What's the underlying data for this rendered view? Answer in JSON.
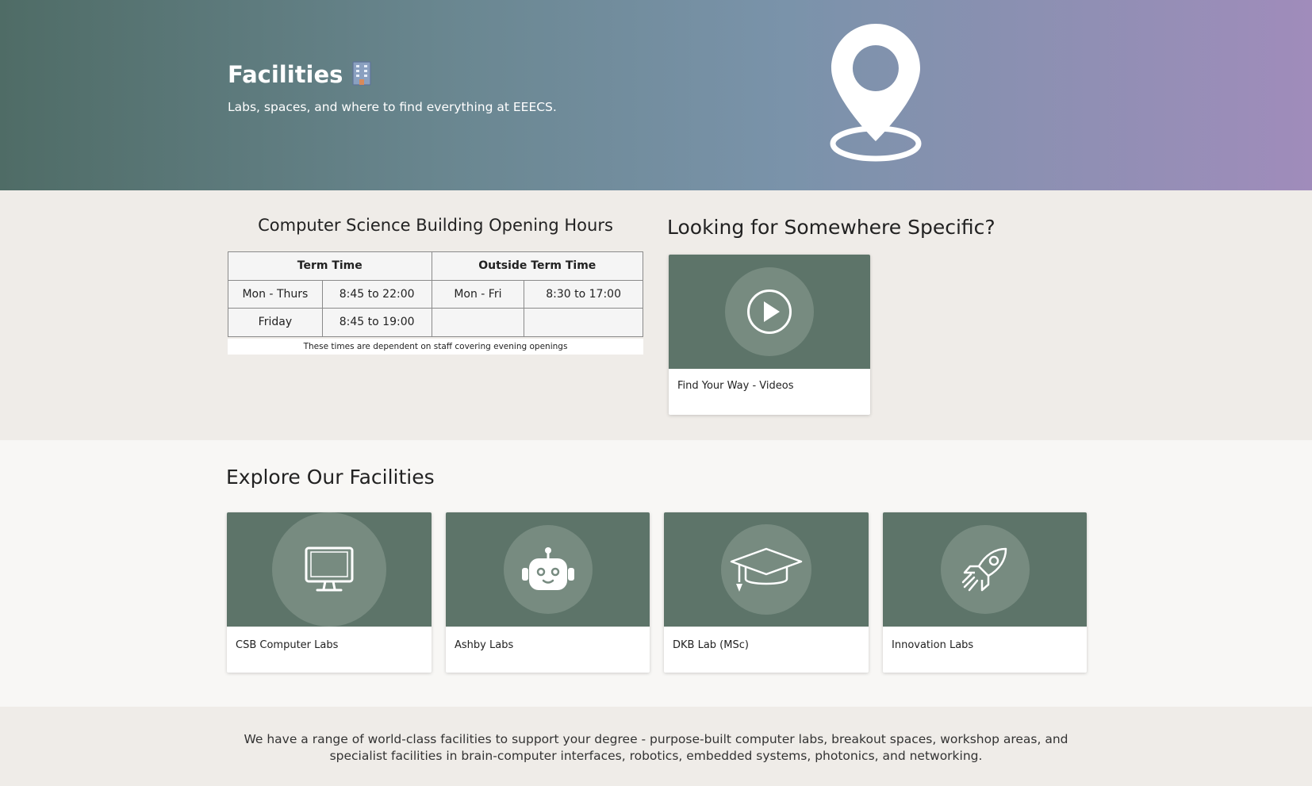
{
  "hero": {
    "title": "Facilities",
    "subtitle": "Labs, spaces, and where to find everything at EEECS.",
    "emoji_icon": "office-building-icon",
    "pin_icon": "map-pin-icon"
  },
  "hours": {
    "title": "Computer Science Building Opening Hours",
    "headers": [
      "Term Time",
      "Outside Term Time"
    ],
    "rows": [
      [
        "Mon - Thurs",
        "8:45 to 22:00",
        "Mon - Fri",
        "8:30 to 17:00"
      ],
      [
        "Friday",
        "8:45 to 19:00",
        "",
        ""
      ]
    ],
    "note": "These times are dependent on staff covering evening openings"
  },
  "specific": {
    "title": "Looking for Somewhere Specific?",
    "card_label": "Find Your Way - Videos",
    "card_icon": "play-icon"
  },
  "explore": {
    "title": "Explore Our Facilities",
    "cards": [
      {
        "label": "CSB Computer Labs",
        "icon": "monitor-icon"
      },
      {
        "label": "Ashby Labs",
        "icon": "robot-icon"
      },
      {
        "label": "DKB Lab (MSc)",
        "icon": "graduation-cap-icon"
      },
      {
        "label": "Innovation Labs",
        "icon": "rocket-icon"
      }
    ]
  },
  "footer": {
    "text": "We have a range of world-class facilities to support your degree - purpose-built computer labs, breakout spaces, workshop areas, and specialist facilities in brain-computer interfaces, robotics, embedded systems, photonics, and networking."
  },
  "colors": {
    "card_media": "#5d7469",
    "card_circle": "#778b80",
    "hero_start": "#4f6c66",
    "hero_end": "#a08cbb"
  }
}
